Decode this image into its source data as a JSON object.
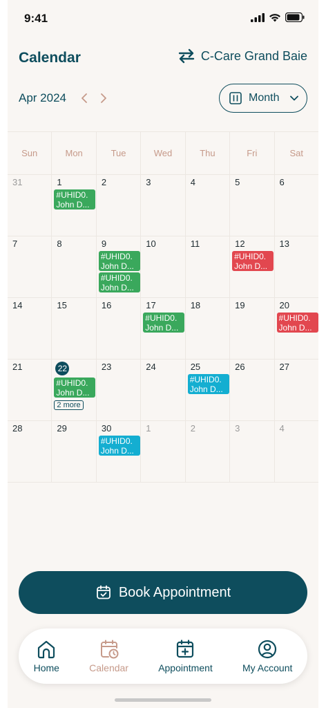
{
  "status_bar": {
    "time": "9:41"
  },
  "header": {
    "title": "Calendar",
    "clinic_name": "C-Care Grand Baie"
  },
  "month_nav": {
    "label": "Apr 2024",
    "view_mode": "Month"
  },
  "calendar": {
    "weekdays": [
      "Sun",
      "Mon",
      "Tue",
      "Wed",
      "Thu",
      "Fri",
      "Sat"
    ],
    "weeks": [
      [
        {
          "day": "31",
          "outside": true,
          "events": []
        },
        {
          "day": "1",
          "events": [
            {
              "id": "#UHID0.",
              "name": "John D...",
              "color": "#3aa85c"
            }
          ]
        },
        {
          "day": "2",
          "events": []
        },
        {
          "day": "3",
          "events": []
        },
        {
          "day": "4",
          "events": []
        },
        {
          "day": "5",
          "events": []
        },
        {
          "day": "6",
          "events": []
        }
      ],
      [
        {
          "day": "7",
          "events": []
        },
        {
          "day": "8",
          "events": []
        },
        {
          "day": "9",
          "events": [
            {
              "id": "#UHID0.",
              "name": "John D...",
              "color": "#3aa85c"
            },
            {
              "id": "#UHID0.",
              "name": "John D...",
              "color": "#3aa85c"
            }
          ]
        },
        {
          "day": "10",
          "events": []
        },
        {
          "day": "11",
          "events": []
        },
        {
          "day": "12",
          "events": [
            {
              "id": "#UHID0.",
              "name": "John D...",
              "color": "#e2474f"
            }
          ]
        },
        {
          "day": "13",
          "events": []
        }
      ],
      [
        {
          "day": "14",
          "events": []
        },
        {
          "day": "15",
          "events": []
        },
        {
          "day": "16",
          "events": []
        },
        {
          "day": "17",
          "events": [
            {
              "id": "#UHID0.",
              "name": "John D...",
              "color": "#3aa85c"
            }
          ]
        },
        {
          "day": "18",
          "events": []
        },
        {
          "day": "19",
          "events": []
        },
        {
          "day": "20",
          "events": [
            {
              "id": "#UHID0.",
              "name": "John D...",
              "color": "#e2474f"
            }
          ]
        }
      ],
      [
        {
          "day": "21",
          "events": []
        },
        {
          "day": "22",
          "today": true,
          "events": [
            {
              "id": "#UHID0.",
              "name": "John D...",
              "color": "#3aa85c"
            }
          ],
          "more": "2 more"
        },
        {
          "day": "23",
          "events": []
        },
        {
          "day": "24",
          "events": []
        },
        {
          "day": "25",
          "events": [
            {
              "id": "#UHID0.",
              "name": "John D...",
              "color": "#14aed1"
            }
          ]
        },
        {
          "day": "26",
          "events": []
        },
        {
          "day": "27",
          "events": []
        }
      ],
      [
        {
          "day": "28",
          "events": []
        },
        {
          "day": "29",
          "events": []
        },
        {
          "day": "30",
          "events": [
            {
              "id": "#UHID0.",
              "name": "John D...",
              "color": "#14aed1"
            }
          ]
        },
        {
          "day": "1",
          "outside": true,
          "events": []
        },
        {
          "day": "2",
          "outside": true,
          "events": []
        },
        {
          "day": "3",
          "outside": true,
          "events": []
        },
        {
          "day": "4",
          "outside": true,
          "events": []
        }
      ]
    ]
  },
  "book_button": {
    "label": "Book Appointment"
  },
  "bottom_nav": {
    "items": [
      {
        "label": "Home",
        "icon": "home-icon",
        "active": false
      },
      {
        "label": "Calendar",
        "icon": "calendar-clock-icon",
        "active": true
      },
      {
        "label": "Appointment",
        "icon": "calendar-plus-icon",
        "active": false
      },
      {
        "label": "My Account",
        "icon": "account-icon",
        "active": false
      }
    ]
  },
  "colors": {
    "primary": "#0e4d5d",
    "accent": "#c69a8a",
    "background": "#f9f6f3",
    "event_green": "#3aa85c",
    "event_red": "#e2474f",
    "event_cyan": "#14aed1"
  }
}
